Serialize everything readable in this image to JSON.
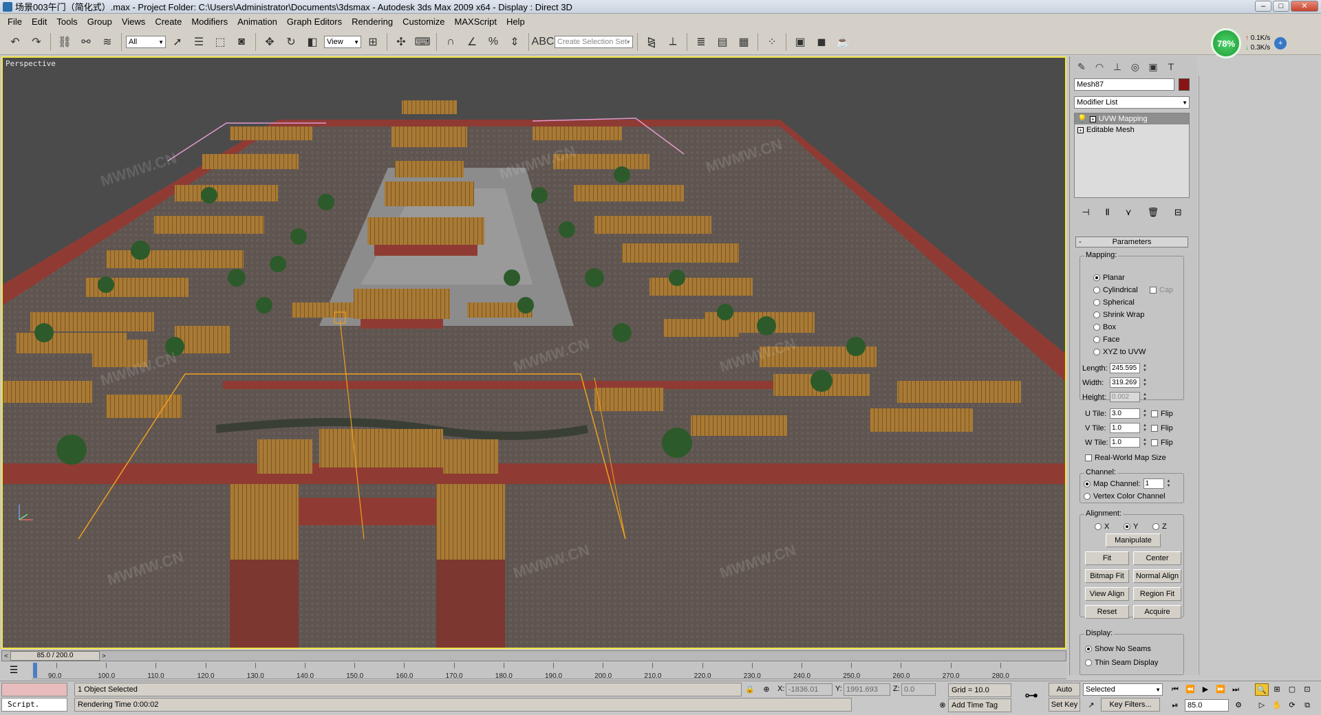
{
  "window": {
    "title": "场景003午门（简化式）.max     - Project Folder: C:\\Users\\Administrator\\Documents\\3dsmax     - Autodesk 3ds Max  2009 x64     - Display : Direct 3D",
    "buttons": [
      "minimize",
      "maximize",
      "close"
    ]
  },
  "menu": [
    "File",
    "Edit",
    "Tools",
    "Group",
    "Views",
    "Create",
    "Modifiers",
    "Animation",
    "Graph Editors",
    "Rendering",
    "Customize",
    "MAXScript",
    "Help"
  ],
  "toolbar": {
    "filter_value": "All",
    "refcoord_value": "View",
    "selection_set_placeholder": "Create Selection Set",
    "icons": [
      "undo-icon",
      "redo-icon",
      "select-link-icon",
      "unlink-icon",
      "bind-spacewarp-icon",
      "select-object-icon",
      "select-by-name-icon",
      "rect-region-icon",
      "window-crossing-icon",
      "move-icon",
      "rotate-icon",
      "scale-icon",
      "pivot-icon",
      "manipulate-icon",
      "keyboard-shortcut-icon",
      "snap-3d-icon",
      "angle-snap-icon",
      "percent-snap-icon",
      "spinner-snap-icon",
      "edit-named-selection-icon",
      "mirror-icon",
      "align-icon",
      "layer-manager-icon",
      "curve-editor-icon",
      "schematic-view-icon",
      "material-editor-icon",
      "render-setup-icon",
      "rendered-frame-icon",
      "quick-render-icon"
    ]
  },
  "network": {
    "percent": "78%",
    "up": "0.1K/s",
    "down": "0.3K/s"
  },
  "viewport": {
    "label": "Perspective",
    "watermark": "MWMW.CN",
    "colors": {
      "border": "#f5e642",
      "background": "#4b4b4b",
      "ground": "#5f5550",
      "wall": "#8f3b33",
      "roof": "#a97a35",
      "tree": "#2d5a2a",
      "plaza": "#8c8c8c"
    }
  },
  "command_panel": {
    "tabs": [
      "create-icon",
      "modify-icon",
      "hierarchy-icon",
      "motion-icon",
      "display-icon",
      "utilities-icon"
    ],
    "object_name": "Mesh87",
    "object_color": "#8a1414",
    "modifier_list": "Modifier List",
    "stack": [
      {
        "label": "UVW Mapping",
        "selected": true
      },
      {
        "label": "Editable Mesh",
        "selected": false
      }
    ],
    "parameters": {
      "title": "Parameters",
      "mapping_title": "Mapping:",
      "mapping_options": [
        {
          "label": "Planar",
          "checked": true
        },
        {
          "label": "Cylindrical",
          "checked": false
        },
        {
          "label": "Spherical",
          "checked": false
        },
        {
          "label": "Shrink Wrap",
          "checked": false
        },
        {
          "label": "Box",
          "checked": false
        },
        {
          "label": "Face",
          "checked": false
        },
        {
          "label": "XYZ to UVW",
          "checked": false
        }
      ],
      "cap_label": "Cap",
      "length_label": "Length:",
      "length": "245.595",
      "width_label": "Width:",
      "width": "319.269",
      "height_label": "Height:",
      "height": "0.002",
      "utile_label": "U Tile:",
      "utile": "3.0",
      "vtile_label": "V Tile:",
      "vtile": "1.0",
      "wtile_label": "W Tile:",
      "wtile": "1.0",
      "flip_label": "Flip",
      "realworld_label": "Real-World Map Size",
      "channel_title": "Channel:",
      "map_channel_label": "Map Channel:",
      "map_channel": "1",
      "vertex_color_label": "Vertex Color Channel",
      "alignment_title": "Alignment:",
      "axis_x": "X",
      "axis_y": "Y",
      "axis_z": "Z",
      "manipulate": "Manipulate",
      "fit": "Fit",
      "center": "Center",
      "bitmap_fit": "Bitmap Fit",
      "normal_align": "Normal Align",
      "view_align": "View Align",
      "region_fit": "Region Fit",
      "reset": "Reset",
      "acquire": "Acquire",
      "display_title": "Display:",
      "show_no_seams": "Show No Seams",
      "thin_seam": "Thin Seam Display"
    }
  },
  "timeline": {
    "thumb": "85.0 / 200.0",
    "ticks": [
      "90.0",
      "100.0",
      "110.0",
      "120.0",
      "130.0",
      "140.0",
      "150.0",
      "160.0",
      "170.0",
      "180.0",
      "190.0",
      "200.0",
      "210.0",
      "220.0",
      "230.0",
      "240.0",
      "250.0",
      "260.0",
      "270.0",
      "280.0"
    ]
  },
  "status": {
    "script_label": "Script.",
    "selected_text": "1 Object Selected",
    "render_time": "Rendering Time  0:00:02",
    "x_label": "X:",
    "x": "-1836.01",
    "y_label": "Y:",
    "y": "1991.693",
    "z_label": "Z:",
    "z": "0.0",
    "grid": "Grid = 10.0",
    "add_time_tag": "Add Time Tag",
    "auto_key": "Auto Key",
    "set_key": "Set Key",
    "key_mode_value": "Selected",
    "key_filters": "Key Filters...",
    "current_frame": "85.0"
  }
}
